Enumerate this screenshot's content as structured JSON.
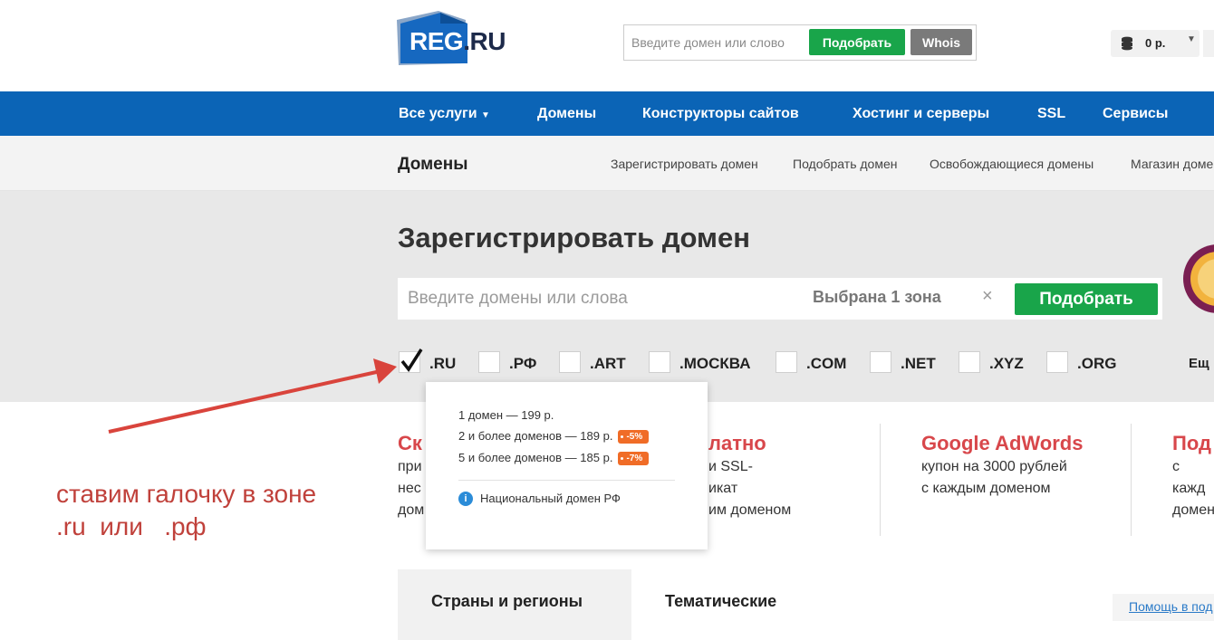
{
  "header": {
    "logo_text": "REG",
    "logo_tld": ".RU",
    "search_placeholder": "Введите домен или слово",
    "pick_button": "Подобрать",
    "whois_button": "Whois",
    "balance": "0 р."
  },
  "main_nav": {
    "items": [
      "Все услуги",
      "Домены",
      "Конструкторы сайтов",
      "Хостинг и серверы",
      "SSL",
      "Сервисы"
    ]
  },
  "sub_nav": {
    "title": "Домены",
    "links": [
      "Зарегистрировать домен",
      "Подобрать домен",
      "Освобождающиеся домены",
      "Магазин доме"
    ]
  },
  "hero": {
    "title": "Зарегистрировать домен",
    "search_placeholder": "Введите домены или слова",
    "zone_count": "Выбрана 1 зона",
    "clear_icon": "×",
    "pick_button": "Подобрать",
    "more": "Ещ",
    "zones": [
      {
        "label": ".RU",
        "checked": true
      },
      {
        "label": ".РФ",
        "checked": false
      },
      {
        "label": ".ART",
        "checked": false
      },
      {
        "label": ".МОСКВА",
        "checked": false
      },
      {
        "label": ".COM",
        "checked": false
      },
      {
        "label": ".NET",
        "checked": false
      },
      {
        "label": ".XYZ",
        "checked": false
      },
      {
        "label": ".ORG",
        "checked": false
      }
    ]
  },
  "popover": {
    "price1": "1 домен — 199 р.",
    "price2": "2 и более доменов — 189 р.",
    "discount2": "-5%",
    "price3": "5 и более доменов — 185 р.",
    "discount3": "-7%",
    "info_icon": "i",
    "note": "Национальный домен РФ"
  },
  "promos": [
    {
      "heading": "Ск",
      "lines": [
        "при",
        "нес",
        "дом"
      ]
    },
    {
      "heading": "латно",
      "lines": [
        "и SSL-",
        "икат",
        "им доменом"
      ]
    },
    {
      "heading": "Google AdWords",
      "lines": [
        "купон на 3000 рублей",
        "с каждым доменом"
      ]
    },
    {
      "heading": "Под",
      "lines": [
        "с кажд",
        "домен"
      ]
    }
  ],
  "annotation": {
    "line1": "ставим галочку в зоне",
    "line2": ".ru  или   .рф",
    "color": "#c0413b"
  },
  "tabs": [
    "Страны и регионы",
    "Тематические"
  ],
  "help_link": "Помощь в под",
  "colors": {
    "brand_blue": "#0b64b6",
    "green": "#19a54a",
    "promo_red": "#d8474b",
    "discount_orange": "#f06c27"
  }
}
